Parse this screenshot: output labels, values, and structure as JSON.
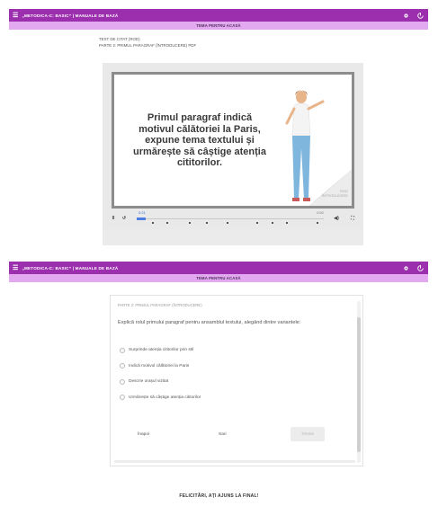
{
  "app": {
    "title": "„METODICA-C: BASIC” | MANUALE DE BAZĂ",
    "subtitle": "TEMA PENTRU ACASĂ",
    "menu_icon": "menu-icon",
    "icons": [
      "settings-icon",
      "exit-icon"
    ],
    "colors": {
      "appbar": "#9b2fae",
      "subbar": "#e3a9f0"
    }
  },
  "lesson": {
    "meta_line1": "TEXT DE CITAT (ROD)",
    "meta_line2": "PARTE 2: PRIMUL PARAGRAF (ÎNTRODUCERE) PDF"
  },
  "slide": {
    "text": "Primul paragraf indică motivul călătoriei la Paris, expune tema textului și urmărește să câștige atenția cititorilor.",
    "corner_label_1": "ROD",
    "corner_label_2": "ÎNTRODUCERE"
  },
  "player": {
    "controls": {
      "play": "II",
      "replay": "↺",
      "current_time": "0:21",
      "end_time": "0:52",
      "volume": "◀)",
      "fullscreen": "⛶"
    },
    "progress": 0.05
  },
  "quiz": {
    "header": "PARTE 2: PRIMUL PARAGRAF (ÎNTRODUCERE)",
    "question": "Explică rolul primului paragraf pentru ansamblul textului, alegând dintre variantele:",
    "options": [
      "Surprinde atenția cititorilor prin stil",
      "Indică motivul călătoriei la Paris",
      "Descrie orașul vizitat",
      "Urmărește să câștige atenția cititorilor"
    ],
    "back_label": "Înapoi",
    "skip_label": "Sari",
    "submit_label": "Trimite"
  },
  "final_message": "FELICITĂRI, AȚI AJUNS LA FINAL!"
}
